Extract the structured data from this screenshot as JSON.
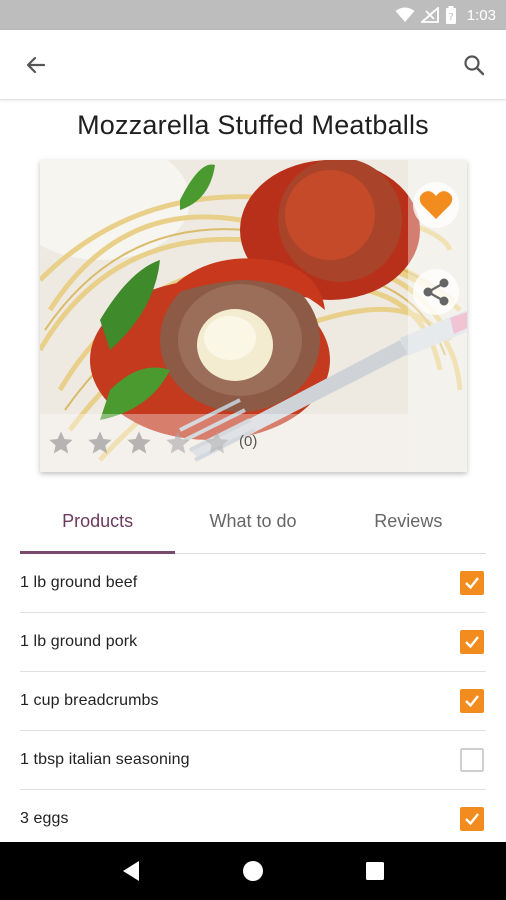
{
  "status_bar": {
    "time": "1:03",
    "icons": [
      "wifi-icon",
      "signal-icon",
      "battery-icon"
    ]
  },
  "app_bar": {
    "back_icon": "arrow-left-icon",
    "search_icon": "search-icon"
  },
  "recipe": {
    "title": "Mozzarella Stuffed Meatballs",
    "rating": 0,
    "rating_max": 5,
    "rating_count_label": "(0)",
    "favorite_icon": "heart-icon",
    "share_icon": "share-icon"
  },
  "tabs": [
    {
      "label": "Products",
      "active": true
    },
    {
      "label": "What to do",
      "active": false
    },
    {
      "label": "Reviews",
      "active": false
    }
  ],
  "ingredients": [
    {
      "label": "1 lb ground beef",
      "checked": true
    },
    {
      "label": "1 lb ground pork",
      "checked": true
    },
    {
      "label": "1 cup breadcrumbs",
      "checked": true
    },
    {
      "label": "1 tbsp italian seasoning",
      "checked": false
    },
    {
      "label": "3 eggs",
      "checked": true
    }
  ],
  "colors": {
    "accent": "#f28c1e",
    "tab_active": "#6b3a5e",
    "status_bar": "#bdbdbd"
  },
  "nav_bar": {
    "icons": [
      "back-triangle-icon",
      "home-circle-icon",
      "recents-square-icon"
    ]
  }
}
